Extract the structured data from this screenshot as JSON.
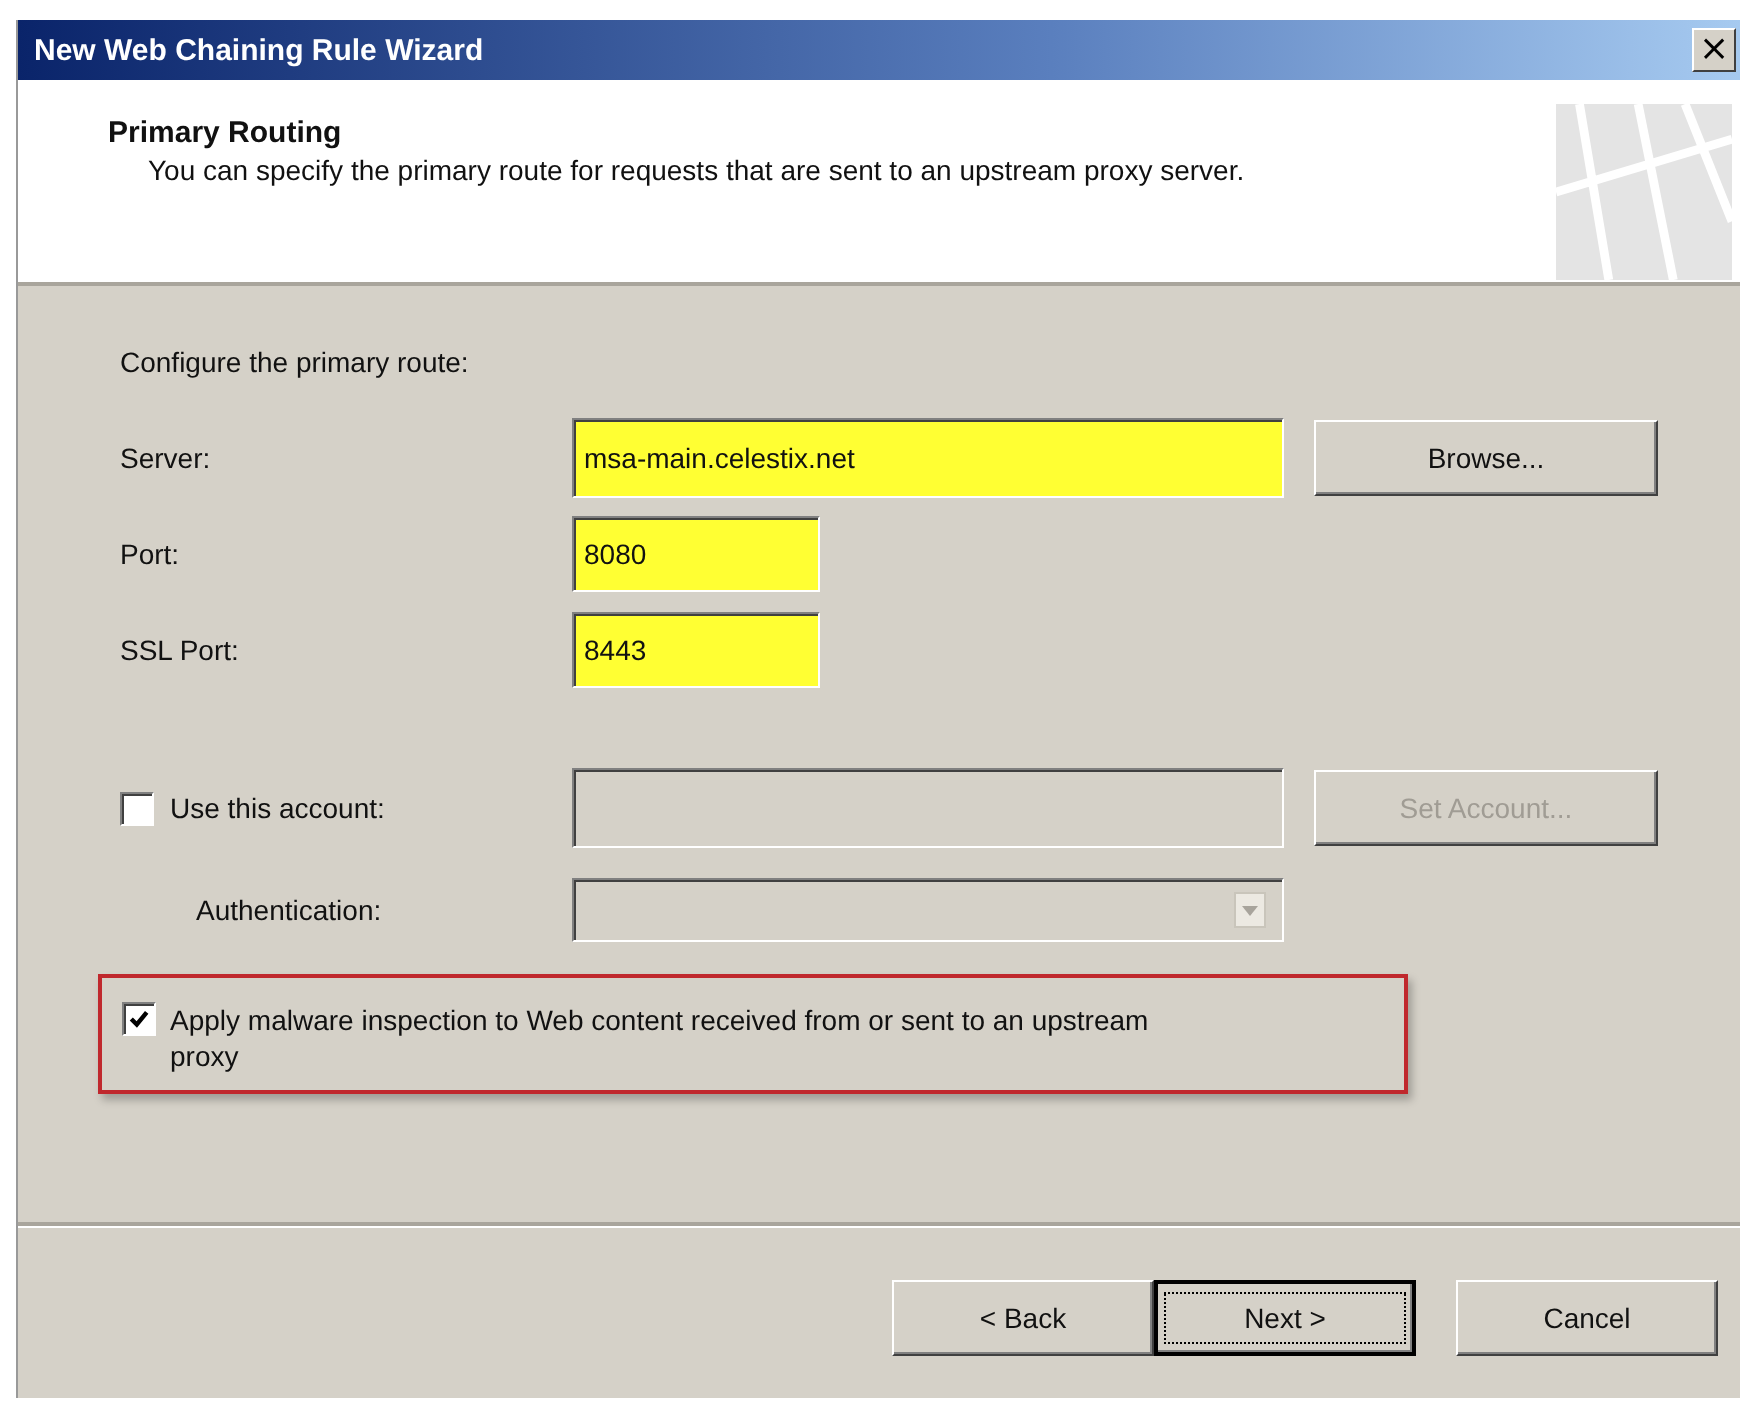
{
  "window": {
    "title": "New Web Chaining Rule Wizard",
    "close": "×"
  },
  "header": {
    "title": "Primary Routing",
    "description": "You can specify the primary route for requests that are sent to an upstream proxy server."
  },
  "section_label": "Configure the primary route:",
  "fields": [
    {
      "label": "Server:",
      "value": "msa-main.celestix.net",
      "highlighted": true,
      "wide": true
    },
    {
      "label": "Port:",
      "value": "8080",
      "highlighted": true,
      "wide": false
    },
    {
      "label": "SSL Port:",
      "value": "8443",
      "highlighted": true,
      "wide": false
    }
  ],
  "browse_button": {
    "label": "Browse...",
    "disabled": false
  },
  "account": {
    "label": "Use this account:",
    "checked": false,
    "field_disabled": true,
    "button": {
      "label": "Set Account...",
      "disabled": true
    }
  },
  "authentication": {
    "label": "Authentication:",
    "disabled": true
  },
  "malware": {
    "label": "Apply malware inspection to Web content received from or sent to an upstream proxy",
    "checked": true,
    "annotated": true
  },
  "buttons": [
    {
      "label": "< Back",
      "default": false
    },
    {
      "label": "Next >",
      "default": true
    },
    {
      "label": "Cancel",
      "default": false
    }
  ]
}
